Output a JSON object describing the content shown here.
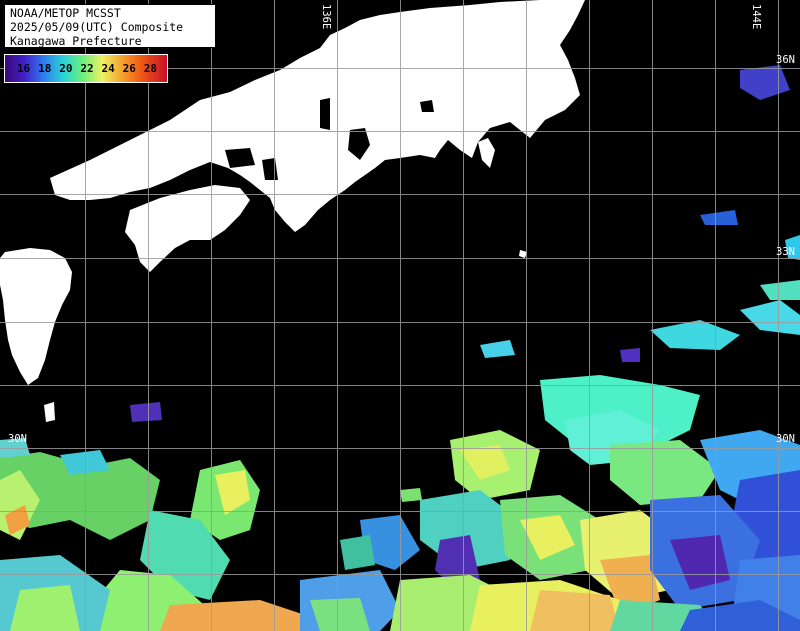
{
  "title": {
    "line1": "NOAA/METOP MCSST",
    "line2": "2025/05/09(UTC) Composite",
    "line3": "Kanagawa Prefecture"
  },
  "scale": {
    "labels": [
      "16",
      "18",
      "20",
      "22",
      "24",
      "26",
      "28"
    ],
    "colors": [
      "#3a0a7a",
      "#4020c8",
      "#2f7cf0",
      "#29d3d8",
      "#6ef07c",
      "#eef062",
      "#f5a430",
      "#ef5a14",
      "#c8102a",
      "#d01040"
    ]
  },
  "grid": {
    "lon_labels": [
      "136E",
      "144E"
    ],
    "lat_labels": [
      "36N",
      "33N",
      "30N",
      "30N"
    ]
  },
  "colors": {
    "land": "#ffffff",
    "sea": "#000000",
    "grid": "#9a9a9a"
  }
}
